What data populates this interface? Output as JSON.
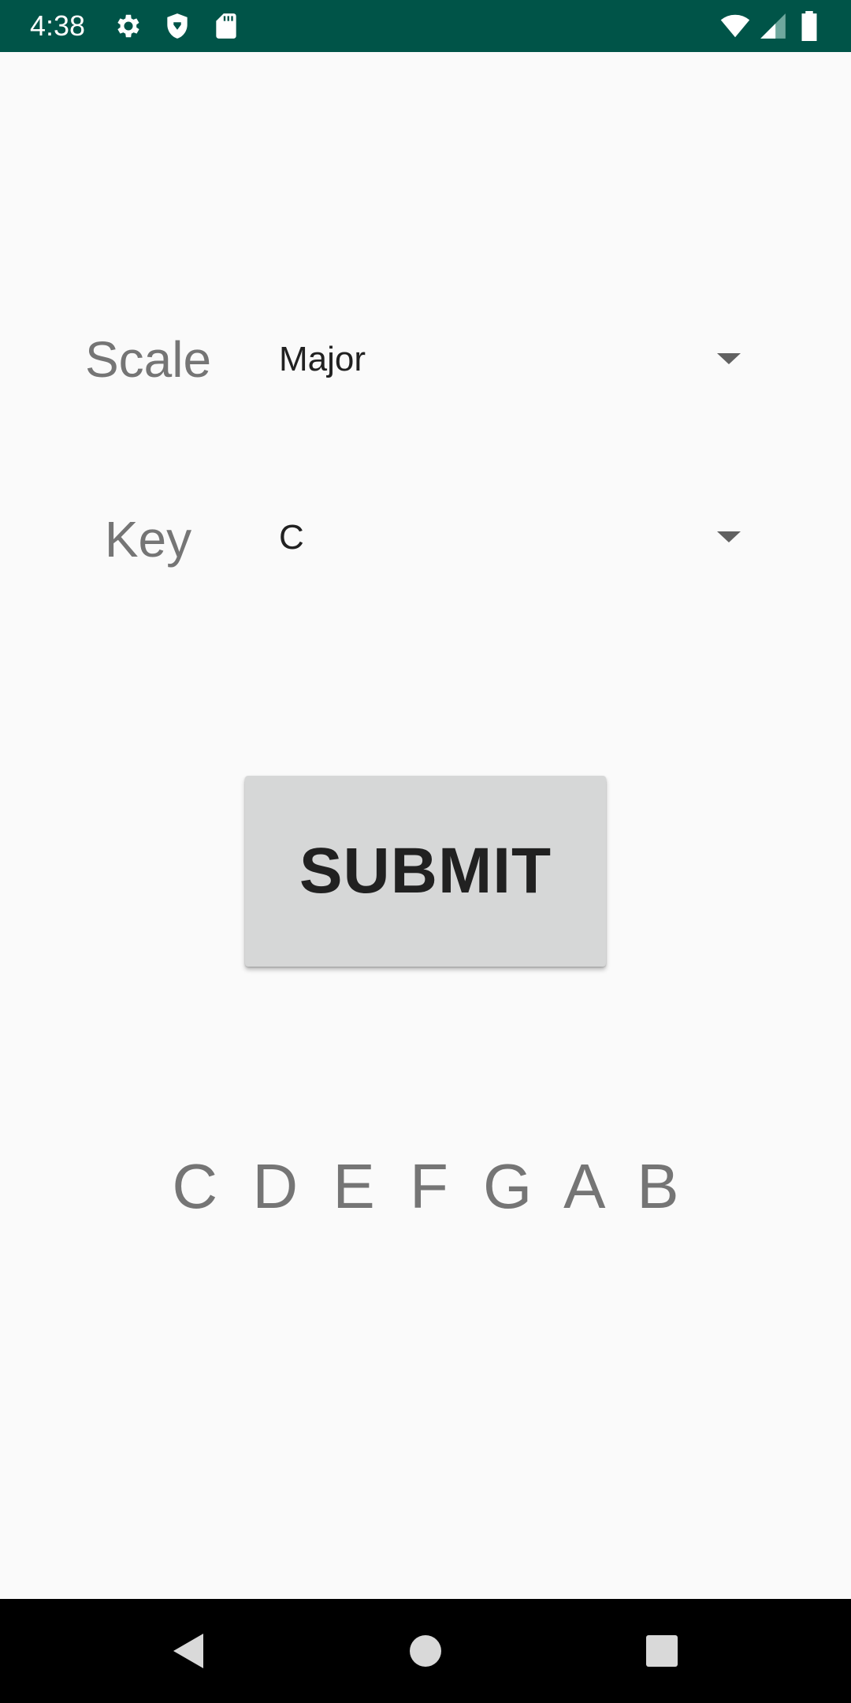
{
  "status_bar": {
    "time": "4:38",
    "icons_left": [
      "settings-gear-icon",
      "shield-icon",
      "sd-card-icon"
    ],
    "icons_right": [
      "wifi-icon",
      "cell-signal-icon",
      "battery-icon"
    ],
    "background_color": "#005448"
  },
  "form": {
    "scale": {
      "label": "Scale",
      "selected": "Major"
    },
    "key": {
      "label": "Key",
      "selected": "C"
    }
  },
  "submit_button": {
    "label": "SUBMIT",
    "background_color": "#D6D7D7"
  },
  "notes_output": {
    "text": "C D E F G A B"
  },
  "nav_bar": {
    "buttons": [
      "back-icon",
      "home-icon",
      "recents-icon"
    ]
  }
}
